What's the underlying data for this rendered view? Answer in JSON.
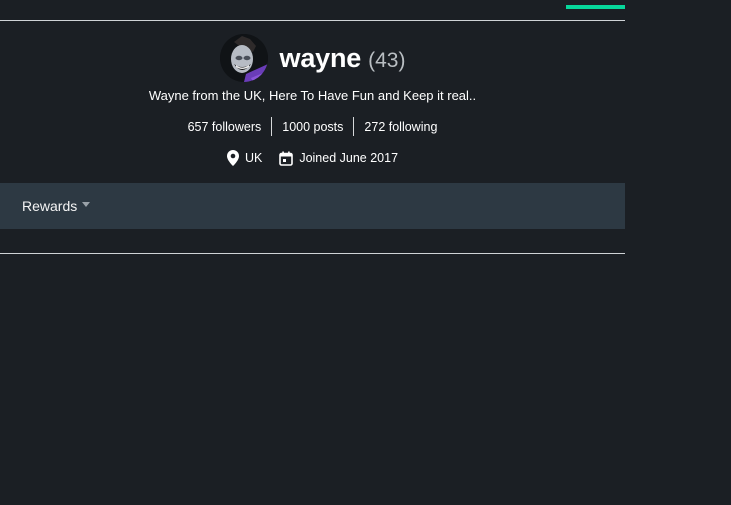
{
  "profile": {
    "username": "wayne",
    "reputation": "(43)",
    "bio": "Wayne from the UK, Here To Have Fun and Keep it real..",
    "avatar_icon": "avatar-icon",
    "stats": {
      "followers": "657 followers",
      "posts": "1000 posts",
      "following": "272 following"
    },
    "location": "UK",
    "joined": "Joined June 2017"
  },
  "icons": {
    "location": "location-pin-icon",
    "calendar": "calendar-icon",
    "dropdown": "chevron-down-icon"
  },
  "tabs": {
    "rewards_label": "Rewards"
  },
  "colors": {
    "background": "#1b1f24",
    "accent": "#07d79a",
    "bar": "#2d3943",
    "text": "#ffffff",
    "muted": "#b9bec2"
  }
}
